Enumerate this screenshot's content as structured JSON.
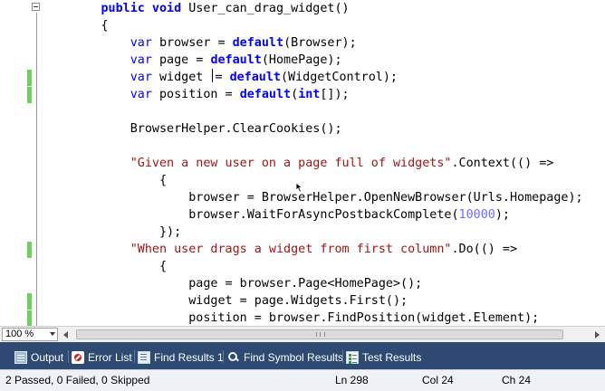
{
  "editor": {
    "lines": [
      [
        {
          "c": "kw",
          "t": "public void "
        },
        {
          "c": "txt",
          "t": "User_can_drag_widget()"
        }
      ],
      [
        {
          "c": "txt",
          "t": "{"
        }
      ],
      [
        {
          "c": "txt",
          "t": "    "
        },
        {
          "c": "kw2",
          "t": "var"
        },
        {
          "c": "txt",
          "t": " browser = "
        },
        {
          "c": "kw",
          "t": "default"
        },
        {
          "c": "txt",
          "t": "(Browser);"
        }
      ],
      [
        {
          "c": "txt",
          "t": "    "
        },
        {
          "c": "kw2",
          "t": "var"
        },
        {
          "c": "txt",
          "t": " page = "
        },
        {
          "c": "kw",
          "t": "default"
        },
        {
          "c": "txt",
          "t": "(HomePage);"
        }
      ],
      [
        {
          "c": "txt",
          "t": "    "
        },
        {
          "c": "kw2",
          "t": "var"
        },
        {
          "c": "txt",
          "t": " widget "
        },
        {
          "c": "caret",
          "t": ""
        },
        {
          "c": "txt",
          "t": "= "
        },
        {
          "c": "kw",
          "t": "default"
        },
        {
          "c": "txt",
          "t": "(WidgetControl);"
        }
      ],
      [
        {
          "c": "txt",
          "t": "    "
        },
        {
          "c": "kw2",
          "t": "var"
        },
        {
          "c": "txt",
          "t": " position = "
        },
        {
          "c": "kw",
          "t": "default"
        },
        {
          "c": "txt",
          "t": "("
        },
        {
          "c": "kw",
          "t": "int"
        },
        {
          "c": "txt",
          "t": "[]);"
        }
      ],
      [
        {
          "c": "txt",
          "t": ""
        }
      ],
      [
        {
          "c": "txt",
          "t": "    BrowserHelper.ClearCookies();"
        }
      ],
      [
        {
          "c": "txt",
          "t": ""
        }
      ],
      [
        {
          "c": "txt",
          "t": "    "
        },
        {
          "c": "str",
          "t": "\"Given a new user on a page full of widgets\""
        },
        {
          "c": "txt",
          "t": ".Context(() =>"
        }
      ],
      [
        {
          "c": "txt",
          "t": "        {"
        }
      ],
      [
        {
          "c": "txt",
          "t": "            browser = BrowserHelper.OpenNewBrowser(Urls.Homepage);"
        }
      ],
      [
        {
          "c": "txt",
          "t": "            browser.WaitForAsyncPostbackComplete("
        },
        {
          "c": "num",
          "t": "10000"
        },
        {
          "c": "txt",
          "t": ");"
        }
      ],
      [
        {
          "c": "txt",
          "t": "        });"
        }
      ],
      [
        {
          "c": "txt",
          "t": "    "
        },
        {
          "c": "str",
          "t": "\"When user drags a widget from first column\""
        },
        {
          "c": "txt",
          "t": ".Do(() =>"
        }
      ],
      [
        {
          "c": "txt",
          "t": "        {"
        }
      ],
      [
        {
          "c": "txt",
          "t": "            page = browser.Page<HomePage>();"
        }
      ],
      [
        {
          "c": "txt",
          "t": "            widget = page.Widgets.First();"
        }
      ],
      [
        {
          "c": "txt",
          "t": "            position = browser.FindPosition(widget.Element);"
        }
      ]
    ],
    "changed_lines": [
      4,
      5,
      14,
      17,
      18
    ]
  },
  "zoom": {
    "value": "100 %"
  },
  "tabs": [
    {
      "label": "Output",
      "icon": "output-icon"
    },
    {
      "label": "Error List",
      "icon": "error-list-icon"
    },
    {
      "label": "Find Results 1",
      "icon": "find-results-icon"
    },
    {
      "label": "Find Symbol Results",
      "icon": "find-symbol-icon"
    },
    {
      "label": "Test Results",
      "icon": "test-results-icon"
    }
  ],
  "status": {
    "message": "2 Passed, 0 Failed, 0 Skipped",
    "line": "Ln 298",
    "col": "Col 24",
    "ch": "Ch 24"
  },
  "colors": {
    "keyword": "#0000ff",
    "string": "#a31515",
    "number": "#6c6cff",
    "tab_strip": "#2e4a72",
    "change_bar": "#6cd35a"
  }
}
